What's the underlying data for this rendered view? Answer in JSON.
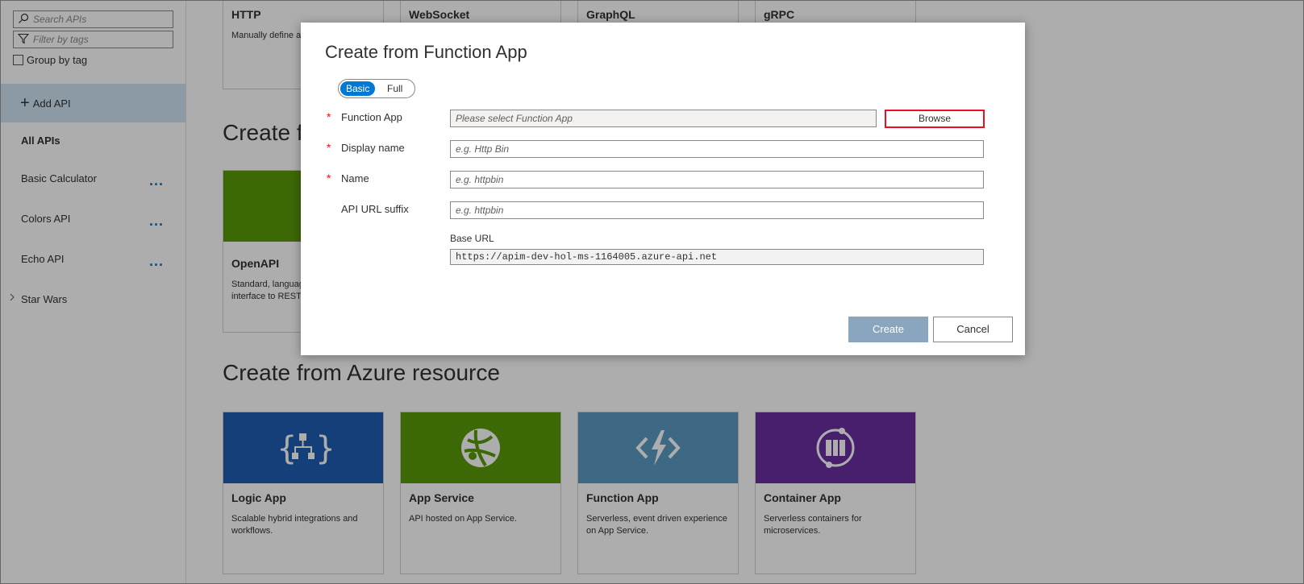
{
  "sidebar": {
    "search_placeholder": "Search APIs",
    "filter_placeholder": "Filter by tags",
    "group_by_tag_label": "Group by tag",
    "add_api_label": "Add API",
    "all_apis_label": "All APIs",
    "apis": [
      {
        "label": "Basic Calculator",
        "more": "..."
      },
      {
        "label": "Colors API",
        "more": "..."
      },
      {
        "label": "Echo API",
        "more": "..."
      }
    ],
    "star_wars_label": "Star Wars"
  },
  "main": {
    "top_cards": [
      {
        "title": "HTTP",
        "desc": "Manually define a"
      },
      {
        "title": "WebSocket",
        "desc": ""
      },
      {
        "title": "GraphQL",
        "desc": ""
      },
      {
        "title": "gRPC",
        "desc": ""
      }
    ],
    "definition_section_title": "Create f",
    "openapi_card": {
      "title": "OpenAPI",
      "desc": "Standard, languag interface to REST"
    },
    "azure_section_title": "Create from Azure resource",
    "azure_cards": [
      {
        "title": "Logic App",
        "desc": "Scalable hybrid integrations and workflows.",
        "color": "#1f5db3",
        "icon": "logic-app-icon"
      },
      {
        "title": "App Service",
        "desc": "API hosted on App Service.",
        "color": "#5b9a0a",
        "icon": "app-service-icon"
      },
      {
        "title": "Function App",
        "desc": "Serverless, event driven experience on App Service.",
        "color": "#5b9bc4",
        "icon": "function-app-icon"
      },
      {
        "title": "Container App",
        "desc": "Serverless containers for microservices.",
        "color": "#6b2fa0",
        "icon": "container-app-icon"
      }
    ]
  },
  "dialog": {
    "title": "Create from Function App",
    "toggle": {
      "basic": "Basic",
      "full": "Full",
      "selected": "Basic"
    },
    "fields": {
      "function_app": {
        "label": "Function App",
        "placeholder": "Please select Function App",
        "required": true
      },
      "display_name": {
        "label": "Display name",
        "placeholder": "e.g. Http Bin",
        "required": true
      },
      "name": {
        "label": "Name",
        "placeholder": "e.g. httpbin",
        "required": true
      },
      "api_url_suffix": {
        "label": "API URL suffix",
        "placeholder": "e.g. httpbin",
        "required": false
      }
    },
    "required_marker": "*",
    "browse_label": "Browse",
    "base_url_label": "Base URL",
    "base_url_value": "https://apim-dev-hol-ms-1164005.azure-api.net",
    "create_label": "Create",
    "cancel_label": "Cancel"
  },
  "colors": {
    "accent": "#0078d4",
    "highlight_border": "#e81123",
    "create_button_disabled": "#8aa6be",
    "openapi_banner": "#5b9a0a"
  }
}
